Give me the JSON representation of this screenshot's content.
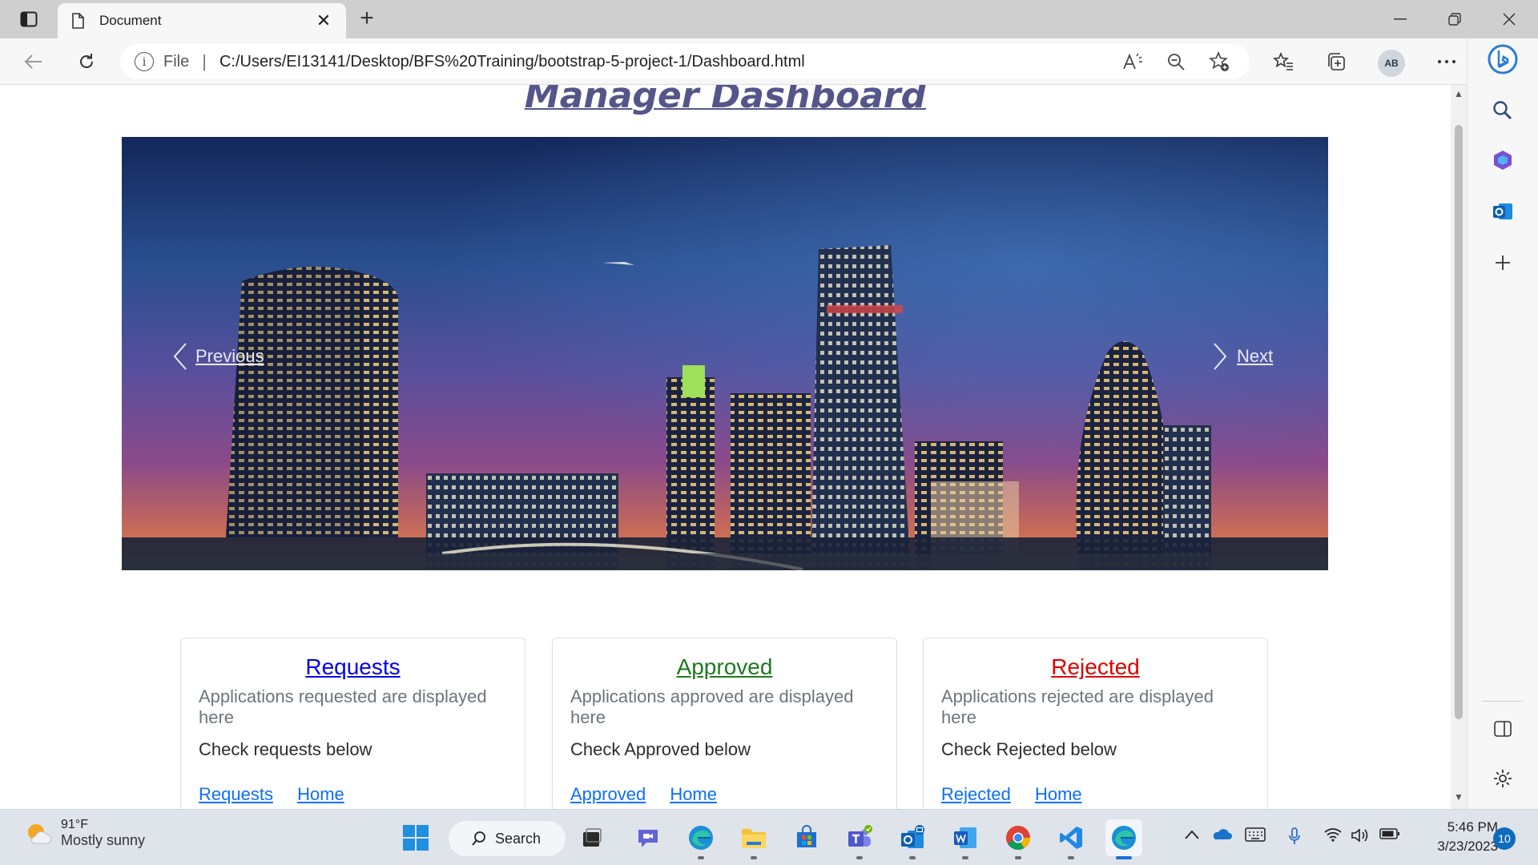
{
  "browser": {
    "tab_title": "Document",
    "address": {
      "scheme_label": "File",
      "url": "C:/Users/EI13141/Desktop/BFS%20Training/bootstrap-5-project-1/Dashboard.html"
    },
    "profile_initials": "AB"
  },
  "page": {
    "title": "Manager Dashboard",
    "carousel": {
      "prev_label": "Previous",
      "next_label": "Next"
    },
    "cards": [
      {
        "title": "Requests",
        "title_color": "#0000ee",
        "subtitle": "Applications requested are displayed here",
        "text": "Check requests below",
        "link1": "Requests",
        "link2": "Home"
      },
      {
        "title": "Approved",
        "title_color": "#1f7a1f",
        "subtitle": "Applications approved are displayed here",
        "text": "Check Approved below",
        "link1": "Approved",
        "link2": "Home"
      },
      {
        "title": "Rejected",
        "title_color": "#e00000",
        "subtitle": "Applications rejected are displayed here",
        "text": "Check Rejected below",
        "link1": "Rejected",
        "link2": "Home"
      }
    ]
  },
  "taskbar": {
    "weather_temp": "91°F",
    "weather_desc": "Mostly sunny",
    "search_label": "Search",
    "time": "5:46 PM",
    "date": "3/23/2023",
    "notification_count": "10"
  },
  "colors": {
    "accent": "#0d6efd",
    "title": "#54568a"
  }
}
